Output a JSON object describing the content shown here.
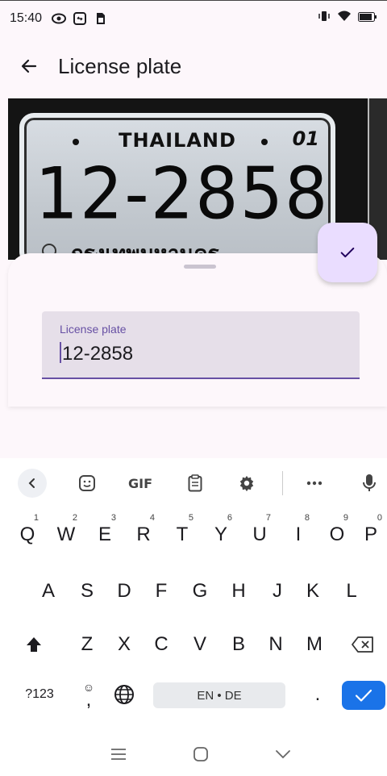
{
  "status_bar": {
    "time": "15:40",
    "icons_left": [
      "eye-icon",
      "screen-record-icon",
      "sim-icon"
    ],
    "icons_right": [
      "vibrate-icon",
      "wifi-icon",
      "battery-icon"
    ]
  },
  "app_bar": {
    "title": "License plate",
    "back_icon": "arrow-left-icon"
  },
  "camera_preview": {
    "plate": {
      "country": "THAILAND",
      "code": "01",
      "number": "12-2858",
      "province": "กรุงเทพมหานคร"
    }
  },
  "sheet": {
    "field": {
      "label": "License plate",
      "value": "12-2858"
    },
    "fab_icon": "check-icon"
  },
  "keyboard": {
    "toolbar": {
      "gif_label": "GIF",
      "items": [
        "chevron-left-icon",
        "sticker-icon",
        "gif",
        "clipboard-icon",
        "settings-icon",
        "more-icon",
        "mic-icon"
      ]
    },
    "row1": [
      {
        "key": "Q",
        "hint": "1"
      },
      {
        "key": "W",
        "hint": "2"
      },
      {
        "key": "E",
        "hint": "3"
      },
      {
        "key": "R",
        "hint": "4"
      },
      {
        "key": "T",
        "hint": "5"
      },
      {
        "key": "Y",
        "hint": "6"
      },
      {
        "key": "U",
        "hint": "7"
      },
      {
        "key": "I",
        "hint": "8"
      },
      {
        "key": "O",
        "hint": "9"
      },
      {
        "key": "P",
        "hint": "0"
      }
    ],
    "row2": [
      "A",
      "S",
      "D",
      "F",
      "G",
      "H",
      "J",
      "K",
      "L"
    ],
    "row3": [
      "Z",
      "X",
      "C",
      "V",
      "B",
      "N",
      "M"
    ],
    "row4": {
      "symbols": "?123",
      "comma": ",",
      "space": "EN • DE",
      "period": "."
    }
  },
  "colors": {
    "accent": "#6750a4",
    "fab_bg": "#eaddff",
    "field_bg": "#e6dfe9",
    "enter_key": "#1a73e8"
  }
}
